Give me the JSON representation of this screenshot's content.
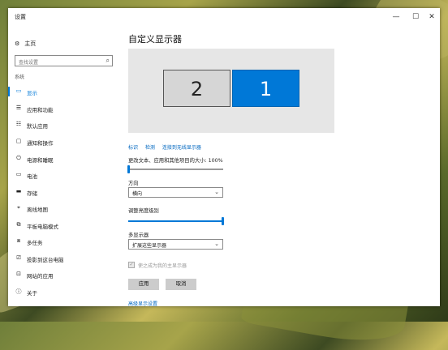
{
  "window": {
    "title": "设置",
    "minimize": "—",
    "maximize": "☐",
    "close": "✕"
  },
  "sidebar": {
    "home": {
      "icon": "gear-icon",
      "glyph": "⚙",
      "label": "主页"
    },
    "search": {
      "placeholder": "查找设置",
      "glyph": "⌕"
    },
    "section": "系统",
    "items": [
      {
        "icon": "monitor-icon",
        "glyph": "▭",
        "label": "显示"
      },
      {
        "icon": "apps-list-icon",
        "glyph": "☰",
        "label": "应用和功能"
      },
      {
        "icon": "default-apps-icon",
        "glyph": "☷",
        "label": "默认应用"
      },
      {
        "icon": "notification-icon",
        "glyph": "▢",
        "label": "通知和操作"
      },
      {
        "icon": "power-icon",
        "glyph": "⏻",
        "label": "电源和睡眠"
      },
      {
        "icon": "battery-icon",
        "glyph": "▭",
        "label": "电池"
      },
      {
        "icon": "storage-icon",
        "glyph": "▬",
        "label": "存储"
      },
      {
        "icon": "offline-maps-icon",
        "glyph": "⌖",
        "label": "离线地图"
      },
      {
        "icon": "tablet-mode-icon",
        "glyph": "⧉",
        "label": "平板电脑模式"
      },
      {
        "icon": "multitasking-icon",
        "glyph": "⧈",
        "label": "多任务"
      },
      {
        "icon": "projecting-icon",
        "glyph": "⎚",
        "label": "投影到这台电脑"
      },
      {
        "icon": "apps-for-websites-icon",
        "glyph": "⊡",
        "label": "网站的应用"
      },
      {
        "icon": "about-icon",
        "glyph": "ⓘ",
        "label": "关于"
      }
    ]
  },
  "main": {
    "heading": "自定义显示器",
    "monitors": {
      "left": "2",
      "right": "1"
    },
    "links": {
      "identify": "标识",
      "detect": "检测",
      "wireless": "连接到无线显示器"
    },
    "scale_label": "更改文本、应用和其他项目的大小: 100%",
    "scale_value": 0.0,
    "orientation_label": "方向",
    "orientation_value": "横向",
    "brightness_label": "调整亮度级别",
    "brightness_value": 1.0,
    "multi_label": "多显示器",
    "multi_value": "扩展这些显示器",
    "main_display_checkbox": "使之成为我的主显示器",
    "apply": "应用",
    "cancel": "取消",
    "advanced": "高级显示设置"
  },
  "colors": {
    "accent": "#0078d7"
  }
}
